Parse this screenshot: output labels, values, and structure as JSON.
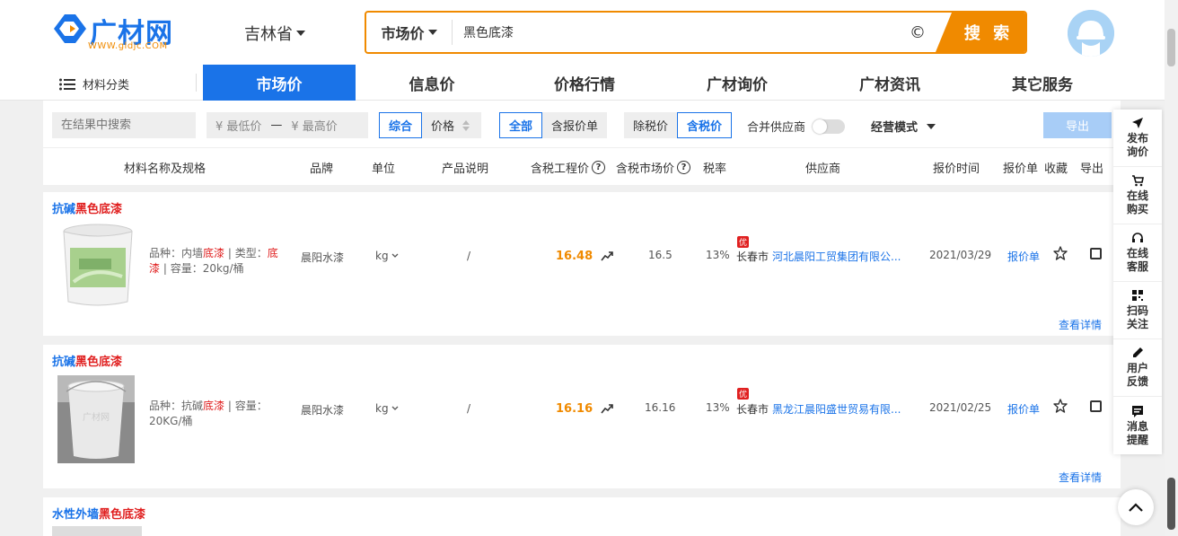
{
  "header": {
    "logo_text": "广材网",
    "logo_sub": "WWW.gldjc.COM",
    "province": "吉林省",
    "search_type": "市场价",
    "search_value": "黑色底漆",
    "search_button": "搜 索"
  },
  "nav": {
    "category": "材料分类",
    "items": [
      "市场价",
      "信息价",
      "价格行情",
      "广材询价",
      "广材资讯",
      "其它服务"
    ]
  },
  "filter": {
    "search_placeholder": "在结果中搜索",
    "min_price": "¥ 最低价",
    "dash": "—",
    "max_price": "¥ 最高价",
    "sort_items": [
      "综合",
      "价格"
    ],
    "scope_items": [
      "全部",
      "含报价单"
    ],
    "tax_items": [
      "除税价",
      "含税价"
    ],
    "merge_label": "合并供应商",
    "mode_label": "经营模式",
    "export_label": "导出"
  },
  "columns": {
    "name": "材料名称及规格",
    "brand": "品牌",
    "unit": "单位",
    "desc": "产品说明",
    "eng_price": "含税工程价",
    "mkt_price": "含税市场价",
    "tax": "税率",
    "supplier": "供应商",
    "date": "报价时间",
    "quote": "报价单",
    "fav": "收藏",
    "export": "导出"
  },
  "products": [
    {
      "title_pre": "抗碱",
      "title_hl": "黑色底漆",
      "spec_a": "品种：内墙",
      "spec_b": "底漆",
      "spec_c": " | 类型：",
      "spec_d": "底漆",
      "spec_e": " | 容量：20kg/桶",
      "brand": "晨阳水漆",
      "unit": "kg",
      "desc": "/",
      "eng_price": "16.48",
      "mkt_price": "16.5",
      "tax": "13%",
      "badge": "优",
      "city": "长春市",
      "supplier": "河北晨阳工贸集团有限公...",
      "date": "2021/03/29",
      "quote": "报价单",
      "details": "查看详情"
    },
    {
      "title_pre": "抗碱",
      "title_hl": "黑色底漆",
      "spec_a": "品种：抗碱",
      "spec_b": "底漆",
      "spec_c": " | 容量：",
      "spec_d": "",
      "spec_e": "20KG/桶",
      "brand": "晨阳水漆",
      "unit": "kg",
      "desc": "/",
      "eng_price": "16.16",
      "mkt_price": "16.16",
      "tax": "13%",
      "badge": "优",
      "city": "长春市",
      "supplier": "黑龙江晨阳盛世贸易有限...",
      "date": "2021/02/25",
      "quote": "报价单",
      "details": "查看详情"
    },
    {
      "title_pre": "水性外墙",
      "title_hl": "黑色底漆"
    }
  ],
  "float_panel": [
    {
      "icon": "send-icon",
      "l1": "发布",
      "l2": "询价"
    },
    {
      "icon": "cart-icon",
      "l1": "在线",
      "l2": "购买"
    },
    {
      "icon": "headset-icon",
      "l1": "在线",
      "l2": "客服"
    },
    {
      "icon": "qrcode-icon",
      "l1": "扫码",
      "l2": "关注"
    },
    {
      "icon": "pen-icon",
      "l1": "用户",
      "l2": "反馈"
    },
    {
      "icon": "message-icon",
      "l1": "消息",
      "l2": "提醒"
    }
  ],
  "colors": {
    "brand_blue": "#1a73e8",
    "accent_orange": "#f08a00",
    "highlight_red": "#e02020"
  }
}
